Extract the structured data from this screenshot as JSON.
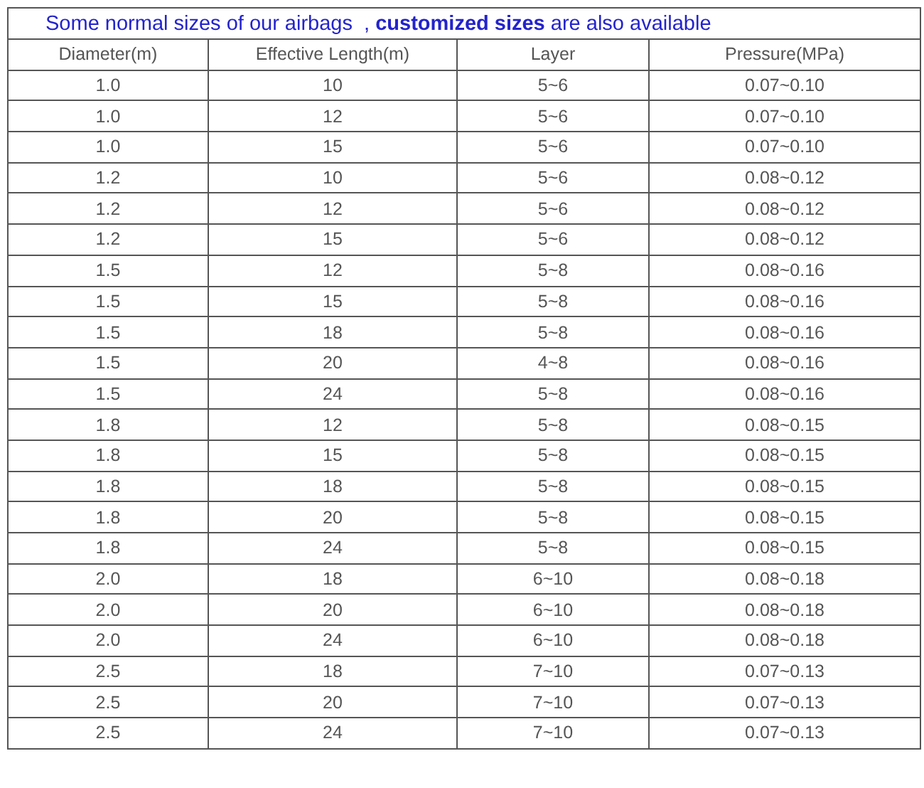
{
  "title": "Some normal sizes of our airbags  , **customized sizes** are also available",
  "table": {
    "columns": [
      "Diameter(m)",
      "Effective Length(m)",
      "Layer",
      "Pressure(MPa)"
    ],
    "rows": [
      [
        "1.0",
        "10",
        "5~6",
        "0.07~0.10"
      ],
      [
        "1.0",
        "12",
        "5~6",
        "0.07~0.10"
      ],
      [
        "1.0",
        "15",
        "5~6",
        "0.07~0.10"
      ],
      [
        "1.2",
        "10",
        "5~6",
        "0.08~0.12"
      ],
      [
        "1.2",
        "12",
        "5~6",
        "0.08~0.12"
      ],
      [
        "1.2",
        "15",
        "5~6",
        "0.08~0.12"
      ],
      [
        "1.5",
        "12",
        "5~8",
        "0.08~0.16"
      ],
      [
        "1.5",
        "15",
        "5~8",
        "0.08~0.16"
      ],
      [
        "1.5",
        "18",
        "5~8",
        "0.08~0.16"
      ],
      [
        "1.5",
        "20",
        "4~8",
        "0.08~0.16"
      ],
      [
        "1.5",
        "24",
        "5~8",
        "0.08~0.16"
      ],
      [
        "1.8",
        "12",
        "5~8",
        "0.08~0.15"
      ],
      [
        "1.8",
        "15",
        "5~8",
        "0.08~0.15"
      ],
      [
        "1.8",
        "18",
        "5~8",
        "0.08~0.15"
      ],
      [
        "1.8",
        "20",
        "5~8",
        "0.08~0.15"
      ],
      [
        "1.8",
        "24",
        "5~8",
        "0.08~0.15"
      ],
      [
        "2.0",
        "18",
        "6~10",
        "0.08~0.18"
      ],
      [
        "2.0",
        "20",
        "6~10",
        "0.08~0.18"
      ],
      [
        "2.0",
        "24",
        "6~10",
        "0.08~0.18"
      ],
      [
        "2.5",
        "18",
        "7~10",
        "0.07~0.13"
      ],
      [
        "2.5",
        "20",
        "7~10",
        "0.07~0.13"
      ],
      [
        "2.5",
        "24",
        "7~10",
        "0.07~0.13"
      ]
    ]
  }
}
